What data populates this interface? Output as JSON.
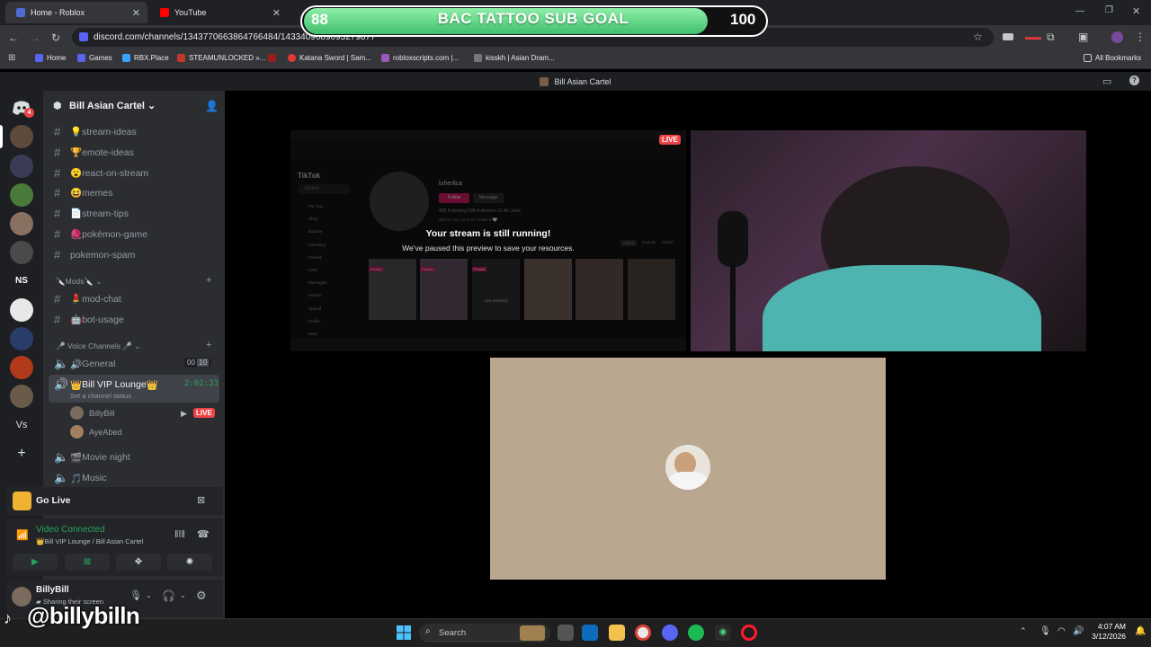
{
  "browser": {
    "tabs": [
      {
        "title": "Home - Roblox",
        "color": "#4f6bd6"
      },
      {
        "title": "YouTube",
        "color": "#ff0000"
      }
    ],
    "url": "discord.com/channels/1343770663864766484/1433409689093279877",
    "bookmarks": [
      {
        "label": "Home",
        "color": "#5865f2"
      },
      {
        "label": "Games",
        "color": "#5865f2"
      },
      {
        "label": "RBX.Place",
        "color": "#3ba0ff"
      },
      {
        "label": "STEAMUNLOCKED »...",
        "color": "#c0392b"
      },
      {
        "label": "Katana Sword | Sam...",
        "color": "#e53935"
      },
      {
        "label": "robloxscripts.com |...",
        "color": "#9b59b6"
      },
      {
        "label": "kisskh | Asian Dram...",
        "color": "#777777"
      }
    ],
    "all_bookmarks": "All Bookmarks"
  },
  "goal": {
    "title": "BAC TATTOO SUB GOAL",
    "current": "88",
    "max": "100",
    "progress": 0.88
  },
  "discord": {
    "window_title": "Bill Asian Cartel",
    "rail_badge": "4",
    "rail_labels": [
      "NS",
      "Vs"
    ],
    "guild_name": "Bill Asian Cartel",
    "channels": [
      {
        "emoji": "💡",
        "name": "stream-ideas"
      },
      {
        "emoji": "🏆",
        "name": "emote-ideas"
      },
      {
        "emoji": "😮",
        "name": "react-on-stream"
      },
      {
        "emoji": "😆",
        "name": "memes"
      },
      {
        "emoji": "📄",
        "name": "stream-tips"
      },
      {
        "emoji": "🧶",
        "name": "pokémon-game"
      },
      {
        "emoji": "",
        "name": "pokemon-spam"
      }
    ],
    "mods_category": "Mods",
    "mod_channels": [
      {
        "emoji": "💄",
        "name": "mod-chat"
      },
      {
        "emoji": "🤖",
        "name": "bot-usage"
      }
    ],
    "voice_category": "Voice Channels",
    "voice": {
      "general": {
        "name": "General",
        "count_a": "00",
        "count_b": "10"
      },
      "vip": {
        "name": "Bill VIP Lounge",
        "timer": "2:02:33",
        "status": "Set a channel status"
      },
      "members": [
        {
          "name": "BillyBill",
          "live": "LIVE"
        },
        {
          "name": "AyeAbed"
        }
      ],
      "movie": "Movie night",
      "music": "Music"
    },
    "go_live": "Go Live",
    "connection": {
      "state": "Video Connected",
      "where": "Bill VIP Lounge / Bill Asian Cartel"
    },
    "user": {
      "name": "BillyBill",
      "status": "Sharing their screen"
    }
  },
  "stage": {
    "live": "LIVE",
    "preview_title": "Your stream is still running!",
    "preview_sub": "We've paused this preview to save your resources.",
    "tiktok": {
      "brand": "TikTok",
      "search": "Search",
      "username": "luherlica",
      "follow": "Follow",
      "message": "Message",
      "stats": "459 Following  638 Followers  12.4K Likes",
      "bio": "ddd.lx / 24 | ua SLPI Chalet ♥ 🤍",
      "tabs": [
        "Latest",
        "Popular",
        "Oldest"
      ],
      "nav": [
        "For You",
        "Shop",
        "Explore",
        "Following",
        "Friends",
        "LIVE",
        "Messages",
        "Activity",
        "Upload",
        "Profile",
        "More"
      ],
      "pinned": "Pinned",
      "just_watched": "Just watched"
    }
  },
  "taskbar": {
    "search": "Search",
    "time": "4:07 AM",
    "date": "3/12/2026"
  },
  "overlay_handle": "@billybilln",
  "colors": {
    "discord_bg": "#2b2d31",
    "green": "#23a55a",
    "live": "#ed4245",
    "goal_fill": "#3fbf6d"
  }
}
